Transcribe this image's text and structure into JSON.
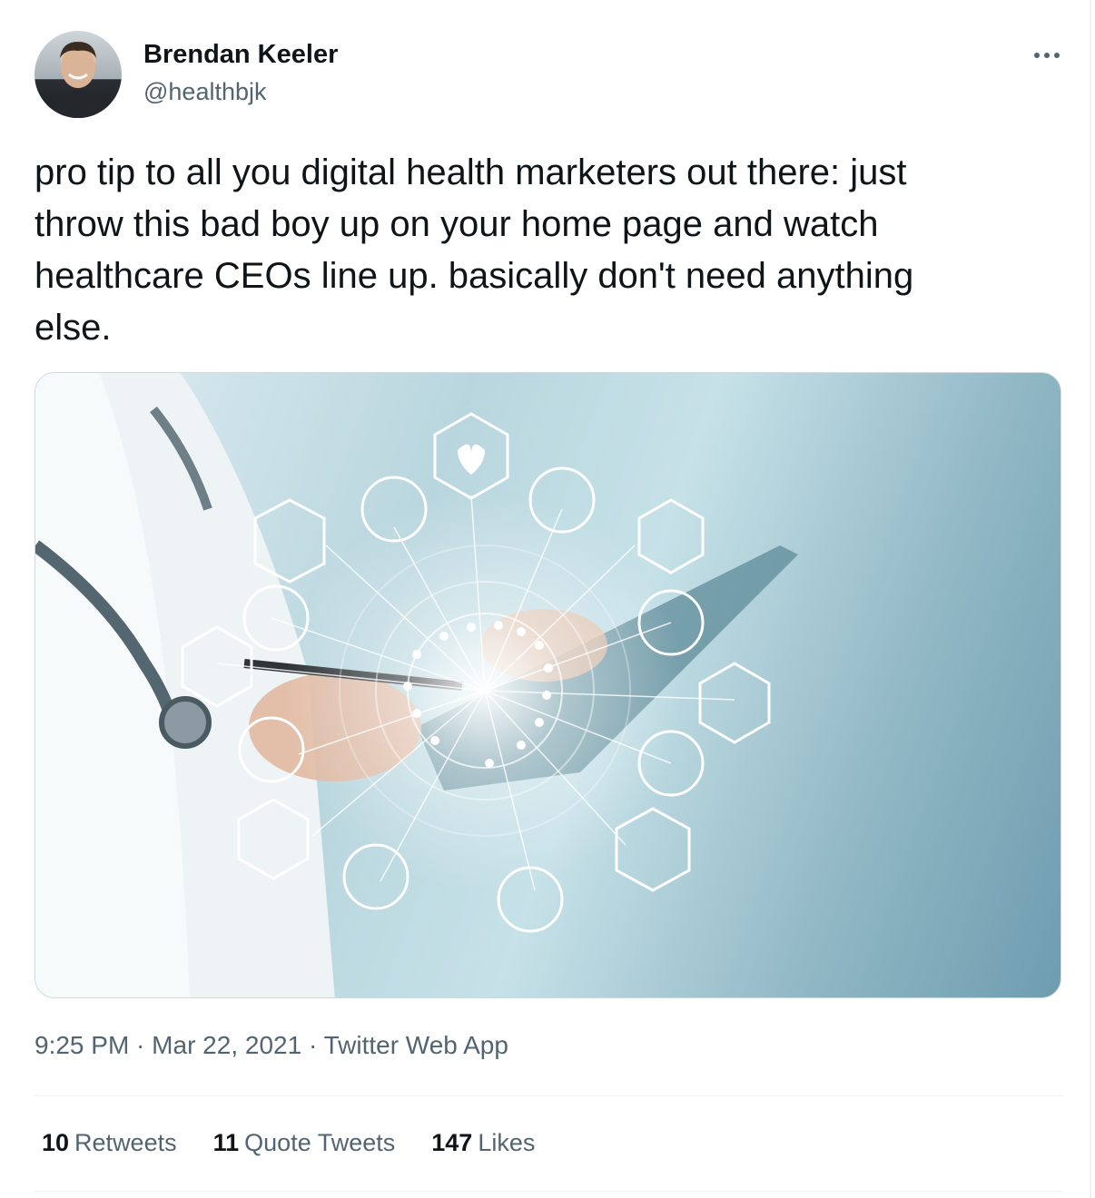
{
  "author": {
    "name": "Brendan Keeler",
    "handle": "@healthbjk"
  },
  "tweet": {
    "text": "pro tip to all you digital health marketers out there: just\nthrow this bad boy up on your home page and watch\nhealthcare CEOs line up. basically don't need anything\nelse."
  },
  "meta": {
    "time": "9:25 PM",
    "sep1": " · ",
    "date": "Mar 22, 2021",
    "sep2": " · ",
    "source": "Twitter Web App"
  },
  "stats": {
    "retweets_count": "10",
    "retweets_label": "Retweets",
    "quotes_count": "11",
    "quotes_label": "Quote Tweets",
    "likes_count": "147",
    "likes_label": "Likes"
  },
  "icons": {
    "more": "more-dots-icon"
  },
  "colors": {
    "text": "#0f1419",
    "secondary": "#536471",
    "border": "#eff3f4"
  }
}
